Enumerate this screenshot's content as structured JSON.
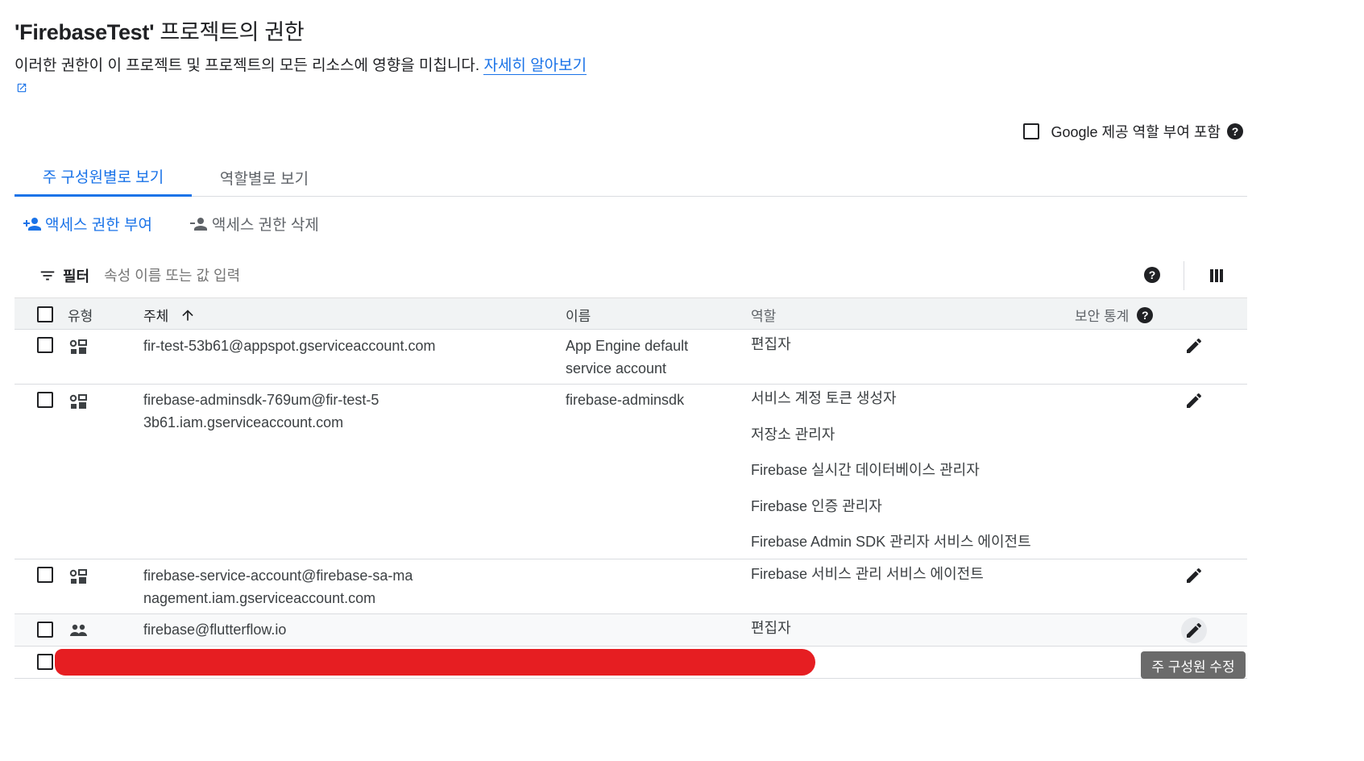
{
  "page": {
    "title_bold": "'FirebaseTest'",
    "title_rest": " 프로젝트의 권한",
    "description": "이러한 권한이 이 프로젝트 및 프로젝트의 모든 리소스에 영향을 미칩니다. ",
    "learn_more_link": "자세히 알아보기"
  },
  "include_google_roles": {
    "label": "Google 제공 역할 부여 포함",
    "checked": false
  },
  "tabs": [
    {
      "label": "주 구성원별로 보기",
      "active": true
    },
    {
      "label": "역할별로 보기",
      "active": false
    }
  ],
  "actions": {
    "grant_label": "액세스 권한 부여",
    "remove_label": "액세스 권한 삭제"
  },
  "filter": {
    "label": "필터",
    "placeholder": "속성 이름 또는 값 입력"
  },
  "table": {
    "headers": {
      "type": "유형",
      "principal": "주체",
      "name": "이름",
      "role": "역할",
      "security": "보안 통계"
    },
    "sort": {
      "column": "주체",
      "direction": "ascending"
    },
    "rows": [
      {
        "type_icon": "service-account-icon",
        "principal": "fir-test-53b61@appspot.gserviceaccount.com",
        "name": "App Engine default service account",
        "roles": [
          "편집자"
        ]
      },
      {
        "type_icon": "service-account-icon",
        "principal": "firebase-adminsdk-769um@fir-test-53b61.iam.gserviceaccount.com",
        "name": "firebase-adminsdk",
        "roles": [
          "서비스 계정 토큰 생성자",
          "저장소 관리자",
          "Firebase 실시간 데이터베이스 관리자",
          "Firebase 인증 관리자",
          "Firebase Admin SDK 관리자 서비스 에이전트"
        ]
      },
      {
        "type_icon": "service-account-icon",
        "principal": "firebase-service-account@firebase-sa-management.iam.gserviceaccount.com",
        "name": "",
        "roles": [
          "Firebase 서비스 관리 서비스 에이전트"
        ]
      },
      {
        "type_icon": "group-icon",
        "principal": "firebase@flutterflow.io",
        "name": "",
        "roles": [
          "편집자"
        ]
      }
    ]
  },
  "tooltip": "주 구성원 수정",
  "colors": {
    "accent": "#1a73e8",
    "redaction": "#e61e22"
  }
}
